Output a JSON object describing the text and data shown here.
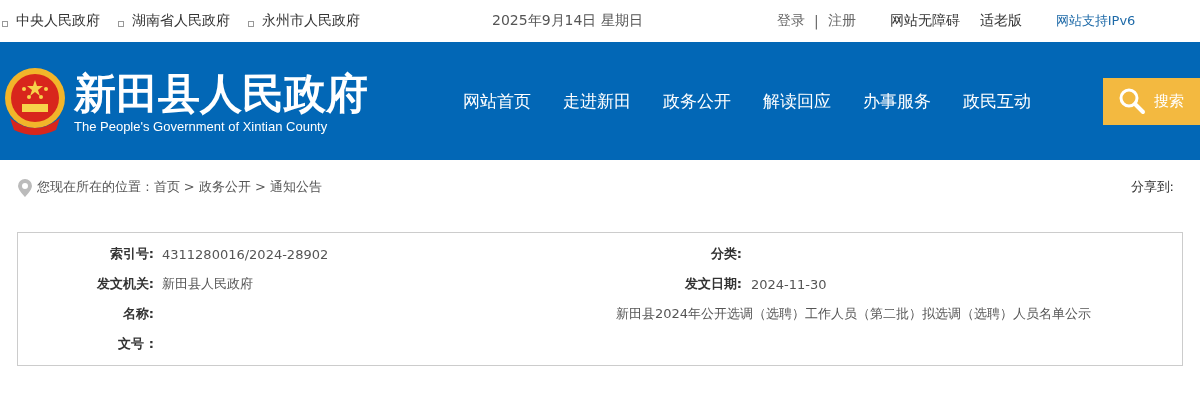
{
  "top_links": [
    "中央人民政府",
    "湖南省人民政府",
    "永州市人民政府"
  ],
  "date": "2025年9月14日 星期日",
  "account": {
    "login": "登录",
    "separator": "|",
    "register": "注册"
  },
  "accessibility": "网站无障碍",
  "elder_mode": "适老版",
  "ipv6": "网站支持IPv6",
  "site": {
    "title": "新田县人民政府",
    "subtitle": "The People's Government of Xintian County"
  },
  "nav": [
    "网站首页",
    "走进新田",
    "政务公开",
    "解读回应",
    "办事服务",
    "政民互动"
  ],
  "search": {
    "label": "搜索"
  },
  "breadcrumb": "您现在所在的位置 : 首页 > 政务公开 > 通知公告",
  "share": "分享到:",
  "info": [
    {
      "label": "索引号:",
      "value": "4311280016/2024-28902",
      "right_label": "分类:"
    },
    {
      "label": "发文机关:",
      "value": "新田县人民政府",
      "right_label": "发文日期:",
      "right_value": "2024-11-30"
    },
    {
      "label": "名称:",
      "right_value": "新田县2024年公开选调（选聘）工作人员（第二批）拟选调（选聘）人员名单公示"
    },
    {
      "label": "文号 :"
    }
  ]
}
